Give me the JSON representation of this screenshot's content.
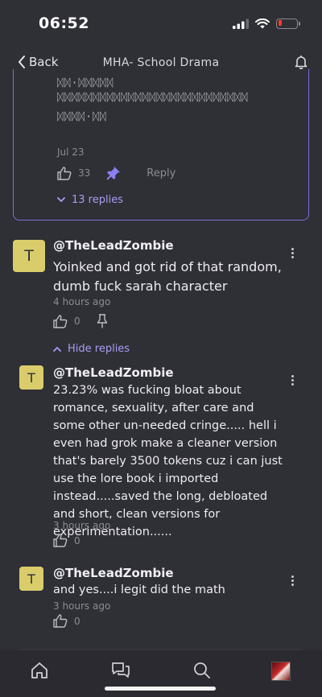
{
  "status_bar": {
    "time": "06:52"
  },
  "nav": {
    "back_label": "Back",
    "title": "MHA- School Drama"
  },
  "prev_comment": {
    "glitch_lines": [
      "ᛞᛞ·ᛞᛞᛞᛞᛞ",
      "ᛞᛞᛞᛞᛞᛞᛞᛞᛞᛞᛞᛞᛞᛞᛞᛞᛞᛞᛞᛞᛞᛞᛞᛞᛞᛞᛞ",
      "ᛞᛞᛞᛞ·ᛞᛞ"
    ],
    "date": "Jul 23",
    "likes": "33",
    "reply_label": "Reply",
    "replies_label": "13 replies"
  },
  "main_comment": {
    "avatar_letter": "T",
    "username": "@TheLeadZombie",
    "text": "Yoinked and got rid of that random, dumb fuck sarah character",
    "time": "4 hours ago",
    "likes": "0",
    "hide_replies_label": "Hide replies"
  },
  "replies": [
    {
      "avatar_letter": "T",
      "username": "@TheLeadZombie",
      "text": "23.23% was fucking bloat about romance, sexuality, after care and some other un-needed cringe..... hell i even had grok make a cleaner version that's barely 3500 tokens cuz i can just use the lore book i imported instead.....saved the long, debloated and short, clean versions for experimentation......",
      "time": "3 hours ago",
      "likes": "0"
    },
    {
      "avatar_letter": "T",
      "username": "@TheLeadZombie",
      "text": "and yes....i legit did the math",
      "time": "3 hours ago",
      "likes": "0"
    }
  ],
  "colors": {
    "accent": "#a99cf2",
    "avatar": "#d8cd6a",
    "background": "#2f2f36"
  },
  "bottom_nav": [
    "home-icon",
    "chat-icon",
    "search-icon",
    "profile-avatar"
  ]
}
